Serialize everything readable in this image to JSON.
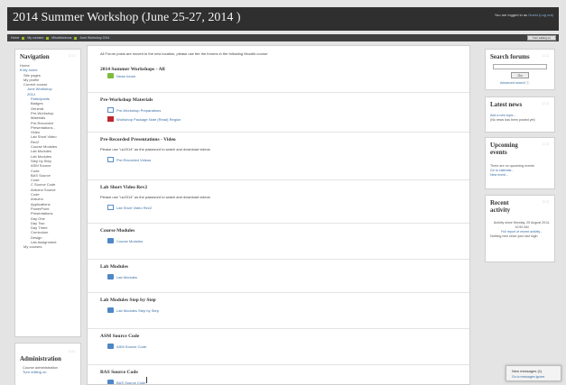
{
  "header": {
    "title": "2014 Summer Workshop (June 25-27, 2014 )",
    "login_text": "You are logged in as",
    "login_user": "Guest",
    "login_action": "(Log out)"
  },
  "navbar": {
    "crumbs": [
      "Home",
      "My courses",
      "Miscellaneous",
      "June Workshop 2014"
    ],
    "edit_button": "Turn editing on"
  },
  "navigation": {
    "title": "Navigation",
    "items": [
      {
        "text": "Home",
        "indent": 0,
        "link": false
      },
      {
        "text": "▾ My home",
        "indent": 0,
        "link": true
      },
      {
        "text": "Site pages",
        "indent": 1,
        "link": false
      },
      {
        "text": "My profile",
        "indent": 1,
        "link": false
      },
      {
        "text": "Current course",
        "indent": 1,
        "link": false
      },
      {
        "text": "June Workshop",
        "indent": 2,
        "link": true
      },
      {
        "text": "2014",
        "indent": 2,
        "link": true
      },
      {
        "text": "Participants",
        "indent": 3,
        "link": true
      },
      {
        "text": "Badges",
        "indent": 3,
        "link": false
      },
      {
        "text": "General",
        "indent": 3,
        "link": false
      },
      {
        "text": "Pre-Workshop",
        "indent": 3,
        "link": false
      },
      {
        "text": "Materials",
        "indent": 3,
        "link": false
      },
      {
        "text": "Pre-Recorded",
        "indent": 3,
        "link": false
      },
      {
        "text": "Presentations -",
        "indent": 3,
        "link": false
      },
      {
        "text": "Video",
        "indent": 3,
        "link": false
      },
      {
        "text": "Lab Short Video",
        "indent": 3,
        "link": false
      },
      {
        "text": "Rev2",
        "indent": 3,
        "link": false
      },
      {
        "text": "Course Modules",
        "indent": 3,
        "link": false
      },
      {
        "text": "Lab Modules",
        "indent": 3,
        "link": false
      },
      {
        "text": "Lab Modules",
        "indent": 3,
        "link": false
      },
      {
        "text": "Step by Step",
        "indent": 3,
        "link": false
      },
      {
        "text": "ASM Source",
        "indent": 3,
        "link": false
      },
      {
        "text": "Code",
        "indent": 3,
        "link": false
      },
      {
        "text": "BAS Source",
        "indent": 3,
        "link": false
      },
      {
        "text": "Code",
        "indent": 3,
        "link": false
      },
      {
        "text": "C Source Code",
        "indent": 3,
        "link": false
      },
      {
        "text": "Arduino Source",
        "indent": 3,
        "link": false
      },
      {
        "text": "Code",
        "indent": 3,
        "link": false
      },
      {
        "text": "Arduino",
        "indent": 3,
        "link": false
      },
      {
        "text": "Applications",
        "indent": 3,
        "link": false
      },
      {
        "text": "PowerPoint",
        "indent": 3,
        "link": false
      },
      {
        "text": "Presentations",
        "indent": 3,
        "link": false
      },
      {
        "text": "Day One",
        "indent": 3,
        "link": false
      },
      {
        "text": "Day Two",
        "indent": 3,
        "link": false
      },
      {
        "text": "Day Three",
        "indent": 3,
        "link": false
      },
      {
        "text": "Curriculum",
        "indent": 3,
        "link": false
      },
      {
        "text": "Design",
        "indent": 3,
        "link": false
      },
      {
        "text": "Lab Assignment",
        "indent": 3,
        "link": false
      },
      {
        "text": "My courses",
        "indent": 1,
        "link": false
      }
    ]
  },
  "administration": {
    "title": "Administration",
    "items": [
      "Course administration",
      "Turn editing on"
    ]
  },
  "main": {
    "notice": "All Forum posts are moved to the new location, please use the the forums in the following Moodle course",
    "sections": [
      {
        "title": "2014 Summer Workshops - All",
        "summary": "",
        "activities": [
          {
            "label": "News forum",
            "icon": "forum"
          }
        ]
      },
      {
        "title": "Pre-Workshop Materials",
        "summary": "",
        "activities": [
          {
            "label": "Pre-Workshop Preparations",
            "icon": "page"
          },
          {
            "label": "Workshop Package Note (Read) Region",
            "icon": "pdf"
          }
        ]
      },
      {
        "title": "Pre-Recorded Presentations - Video",
        "summary": "Please use \"uc2014\" as the password to watch and download videos",
        "activities": [
          {
            "label": "Pre-Recorded Videos",
            "icon": "page"
          }
        ]
      },
      {
        "title": "Lab Short Video Rev2",
        "summary": "Please use \"uc2014\" as the password to watch and download videos",
        "activities": [
          {
            "label": "Lab Short Video Rev2",
            "icon": "page"
          }
        ]
      },
      {
        "title": "Course Modules",
        "summary": "",
        "activities": [
          {
            "label": "Course Modules",
            "icon": "folder"
          }
        ]
      },
      {
        "title": "Lab Modules",
        "summary": "",
        "activities": [
          {
            "label": "Lab Modules",
            "icon": "folder"
          }
        ]
      },
      {
        "title": "Lab Modules Step by Step",
        "summary": "",
        "activities": [
          {
            "label": "Lab Modules Step by Step",
            "icon": "folder"
          }
        ]
      },
      {
        "title": "ASM Source Code",
        "summary": "",
        "activities": [
          {
            "label": "ASM Source Code",
            "icon": "folder"
          }
        ]
      },
      {
        "title": "BAS Source Code",
        "summary": "",
        "activities": [
          {
            "label": "BAS Source Code",
            "icon": "folder"
          }
        ]
      }
    ]
  },
  "search_forums": {
    "title": "Search forums",
    "go": "Go",
    "advanced": "Advanced search"
  },
  "latest_news": {
    "title": "Latest news",
    "add": "Add a new topic...",
    "none": "(No news has been posted yet)"
  },
  "upcoming": {
    "title": "Upcoming events",
    "text": "There are no upcoming events",
    "goto": "Go to calendar...",
    "new_event": "New event..."
  },
  "recent": {
    "title": "Recent activity",
    "since": "Activity since Monday, 25 August 2014, 10:50 AM",
    "full": "Full report of recent activity...",
    "nothing": "Nothing new since your last login"
  },
  "popup": {
    "line1": "New messages (1)",
    "line2": "Go to messages   Ignore"
  },
  "colors": {
    "header_bg": "#2f2f2f",
    "link": "#3a6ea5",
    "forum_icon": "#7dbb3d",
    "folder_icon": "#4f87c8",
    "pdf_icon": "#c0272d"
  }
}
